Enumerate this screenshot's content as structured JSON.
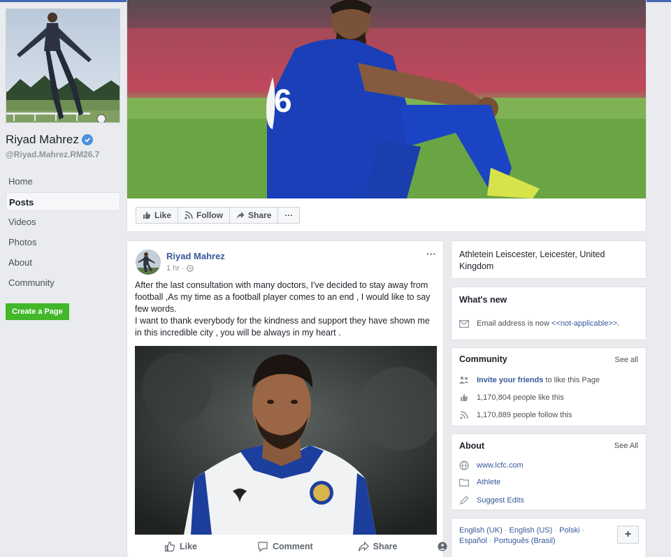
{
  "page": {
    "name": "Riyad Mahrez",
    "handle": "@Riyad.Mahrez.RM26.7"
  },
  "nav": {
    "items": [
      {
        "label": "Home",
        "active": false
      },
      {
        "label": "Posts",
        "active": true
      },
      {
        "label": "Videos",
        "active": false
      },
      {
        "label": "Photos",
        "active": false
      },
      {
        "label": "About",
        "active": false
      },
      {
        "label": "Community",
        "active": false
      }
    ],
    "create_page_label": "Create a Page"
  },
  "cover_actions": {
    "like": "Like",
    "follow": "Follow",
    "share": "Share",
    "more": "···"
  },
  "post": {
    "author": "Riyad Mahrez",
    "time": "1 hr ·",
    "more": "···",
    "paragraph1": "After the last consultation with many doctors, I've decided to stay away from football ,As my time as a football player comes to an end , I would like to say few words.",
    "paragraph2": "I want to thank everybody for the kindness and support they have shown me in this incredible city , you will be always in my heart .",
    "actions": {
      "like": "Like",
      "comment": "Comment",
      "share": "Share"
    }
  },
  "sidebar": {
    "location": "Athletein Leiscester, Leicester, United Kingdom",
    "whats_new": {
      "title": "What's new",
      "email_text": "Email address is now ",
      "email_value": "<<not-applicable>>."
    },
    "community": {
      "title": "Community",
      "see_all": "See all",
      "invite_link": "Invite your friends",
      "invite_rest": " to like this Page",
      "likes": "1,170,804 people like this",
      "follows": "1,170,889 people follow this"
    },
    "about": {
      "title": "About",
      "see_all": "See All",
      "website": "www.lcfc.com",
      "category": "Athlete",
      "suggest": "Suggest Edits"
    },
    "languages": {
      "line1": [
        "English (UK)",
        "English (US)",
        "Polski"
      ],
      "line2": [
        "Español",
        "Português (Brasil)"
      ],
      "sep": " · ",
      "plus": "+"
    }
  },
  "colors": {
    "link": "#365899",
    "accent": "#4267b2",
    "create_button": "#42b72a",
    "background": "#e9ebee"
  }
}
